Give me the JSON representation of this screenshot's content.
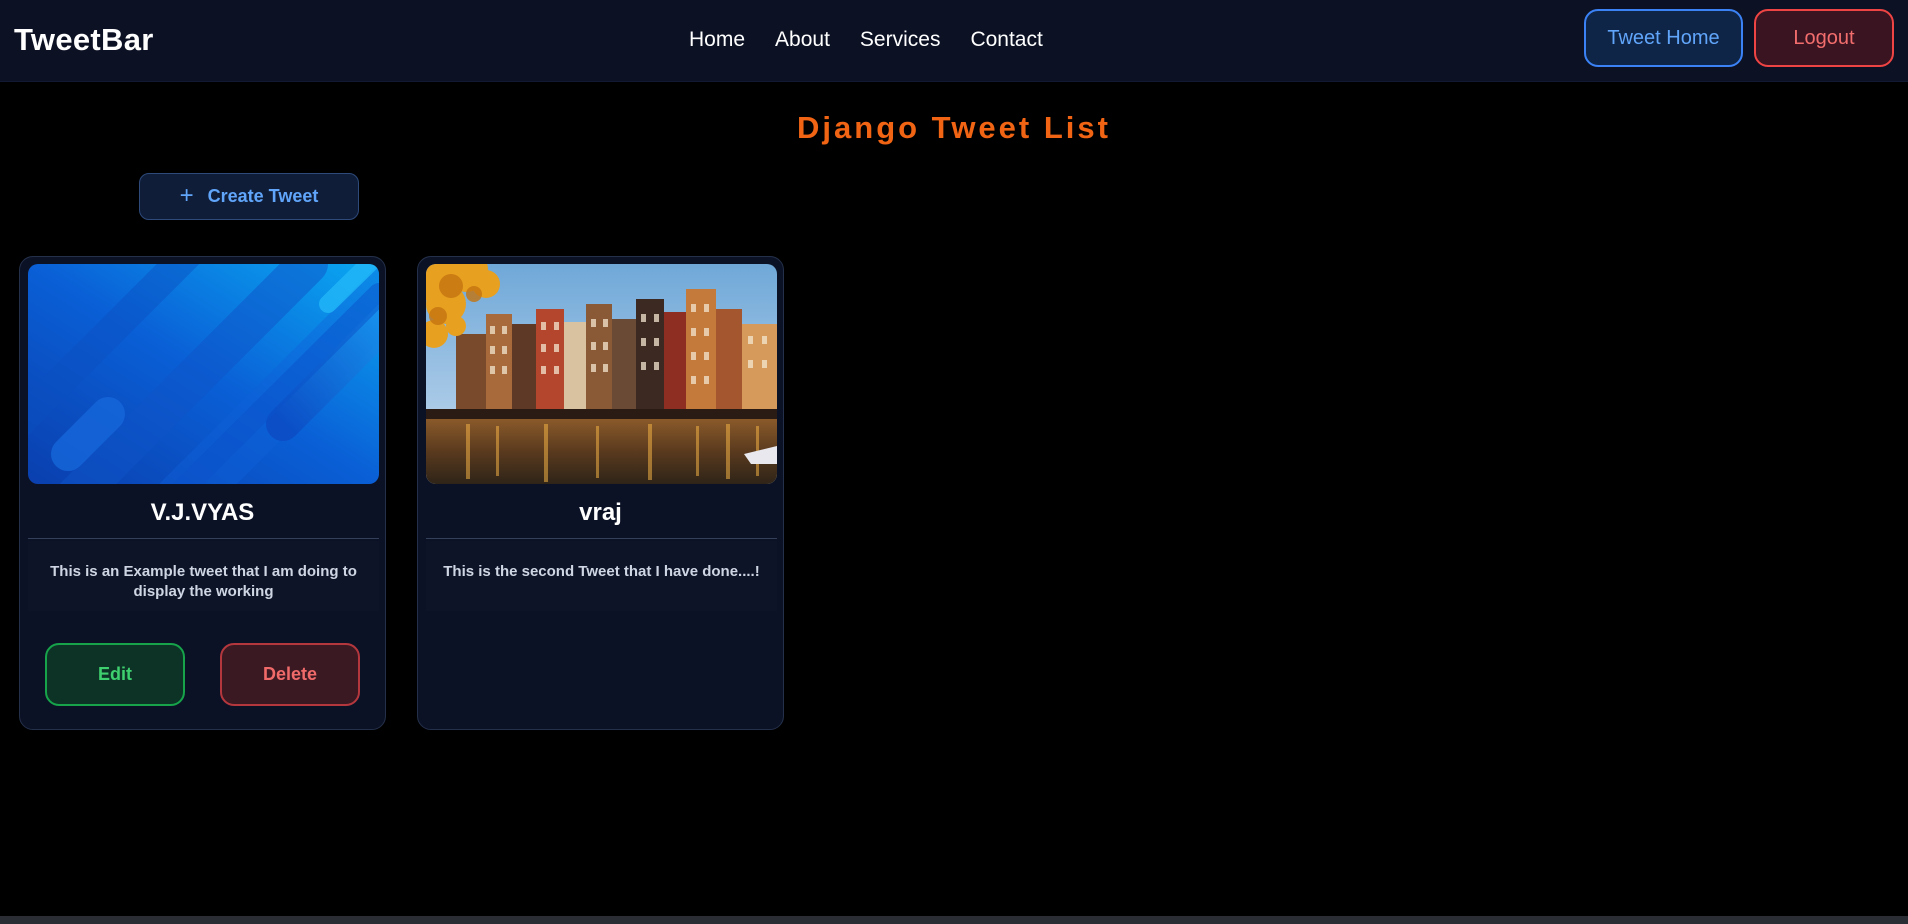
{
  "navbar": {
    "brand": "TweetBar",
    "links": [
      "Home",
      "About",
      "Services",
      "Contact"
    ],
    "tweet_home_label": "Tweet Home",
    "logout_label": "Logout"
  },
  "page": {
    "title": "Django Tweet List",
    "create_button_icon": "+",
    "create_button_label": "Create Tweet"
  },
  "tweets": [
    {
      "author": "V.J.VYAS",
      "image": "blue-abstract-gradient-image",
      "text": "This is an Example tweet that I am doing to display the working",
      "edit_label": "Edit",
      "delete_label": "Delete"
    },
    {
      "author": "vraj",
      "image": "amsterdam-canal-houses-image",
      "text": "This is the second Tweet that I have done....!"
    }
  ],
  "colors": {
    "accent_orange": "#f06414",
    "blue": "#60a5fa",
    "red": "#ef4444",
    "green": "#16a34a",
    "navbar_bg": "#0c1224"
  }
}
